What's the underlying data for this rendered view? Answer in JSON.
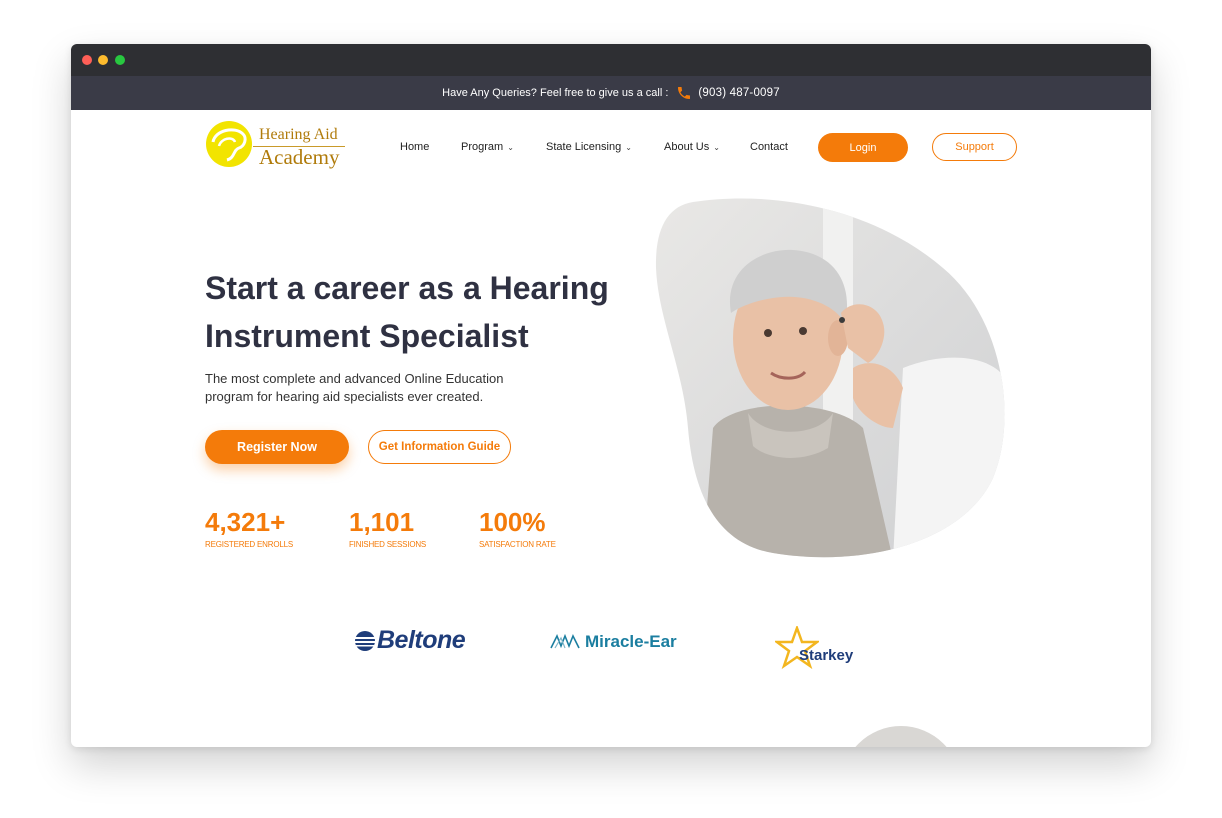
{
  "topbar": {
    "query_text": "Have Any Queries? Feel free to give us a call :",
    "phone": "(903) 487-0097"
  },
  "logo": {
    "line1": "Hearing Aid",
    "line2": "Academy"
  },
  "nav": {
    "items": [
      {
        "label": "Home",
        "dropdown": false
      },
      {
        "label": "Program",
        "dropdown": true
      },
      {
        "label": "State Licensing",
        "dropdown": true
      },
      {
        "label": "About Us",
        "dropdown": true
      },
      {
        "label": "Contact",
        "dropdown": false
      }
    ],
    "login_label": "Login",
    "support_label": "Support"
  },
  "hero": {
    "title": "Start a career as a Hearing Instrument Specialist",
    "subtitle": "The most complete and advanced Online Education program for hearing aid specialists ever created.",
    "register_label": "Register Now",
    "guide_label": "Get Information Guide"
  },
  "stats": [
    {
      "value": "4,321+",
      "label": "REGISTERED ENROLLS"
    },
    {
      "value": "1,101",
      "label": "FINISHED SESSIONS"
    },
    {
      "value": "100%",
      "label": "SATISFACTION RATE"
    }
  ],
  "brands": {
    "beltone": "Beltone",
    "miracle_ear": "Miracle-Ear",
    "starkey": "Starkey"
  },
  "colors": {
    "accent": "#f47b0a",
    "dark": "#2f3142",
    "topbar": "#3a3b47"
  }
}
